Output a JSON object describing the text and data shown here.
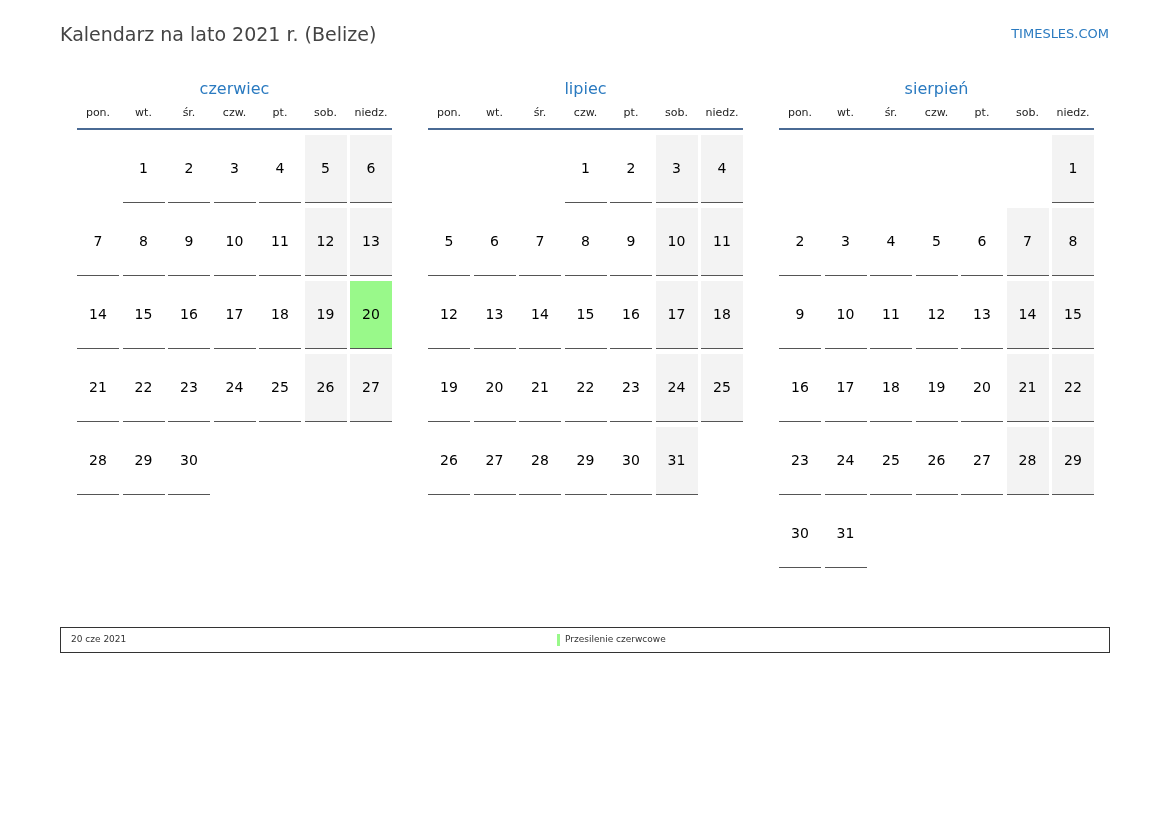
{
  "title": "Kalendarz na lato 2021 r. (Belize)",
  "site": "TIMESLES.COM",
  "months": [
    {
      "name": "czerwiec",
      "weekdays": [
        "pon.",
        "wt.",
        "śr.",
        "czw.",
        "pt.",
        "sob.",
        "niedz."
      ],
      "weeks": [
        {
          "kind": "first",
          "days": [
            {
              "d": "1",
              "kind": "weekday"
            },
            {
              "d": "2",
              "kind": "weekday"
            },
            {
              "d": "3",
              "kind": "weekday"
            },
            {
              "d": "4",
              "kind": "weekday"
            },
            {
              "d": "5",
              "kind": "weekend"
            },
            {
              "d": "6",
              "kind": "weekend"
            }
          ]
        },
        {
          "kind": "middle",
          "days": [
            {
              "d": "7",
              "kind": "weekday"
            },
            {
              "d": "8",
              "kind": "weekday"
            },
            {
              "d": "9",
              "kind": "weekday"
            },
            {
              "d": "10",
              "kind": "weekday"
            },
            {
              "d": "11",
              "kind": "weekday"
            },
            {
              "d": "12",
              "kind": "weekend"
            },
            {
              "d": "13",
              "kind": "weekend"
            }
          ]
        },
        {
          "kind": "middle",
          "days": [
            {
              "d": "14",
              "kind": "weekday"
            },
            {
              "d": "15",
              "kind": "weekday"
            },
            {
              "d": "16",
              "kind": "weekday"
            },
            {
              "d": "17",
              "kind": "weekday"
            },
            {
              "d": "18",
              "kind": "weekday"
            },
            {
              "d": "19",
              "kind": "weekend"
            },
            {
              "d": "20",
              "kind": "holiday",
              "color": "#99f98a"
            }
          ]
        },
        {
          "kind": "middle",
          "days": [
            {
              "d": "21",
              "kind": "weekday"
            },
            {
              "d": "22",
              "kind": "weekday"
            },
            {
              "d": "23",
              "kind": "weekday"
            },
            {
              "d": "24",
              "kind": "weekday"
            },
            {
              "d": "25",
              "kind": "weekday"
            },
            {
              "d": "26",
              "kind": "weekend"
            },
            {
              "d": "27",
              "kind": "weekend"
            }
          ]
        },
        {
          "kind": "last",
          "days": [
            {
              "d": "28",
              "kind": "weekday"
            },
            {
              "d": "29",
              "kind": "weekday"
            },
            {
              "d": "30",
              "kind": "weekday"
            }
          ]
        }
      ]
    },
    {
      "name": "lipiec",
      "weekdays": [
        "pon.",
        "wt.",
        "śr.",
        "czw.",
        "pt.",
        "sob.",
        "niedz."
      ],
      "weeks": [
        {
          "kind": "first",
          "days": [
            {
              "d": "1",
              "kind": "weekday"
            },
            {
              "d": "2",
              "kind": "weekday"
            },
            {
              "d": "3",
              "kind": "weekend"
            },
            {
              "d": "4",
              "kind": "weekend"
            }
          ]
        },
        {
          "kind": "middle",
          "days": [
            {
              "d": "5",
              "kind": "weekday"
            },
            {
              "d": "6",
              "kind": "weekday"
            },
            {
              "d": "7",
              "kind": "weekday"
            },
            {
              "d": "8",
              "kind": "weekday"
            },
            {
              "d": "9",
              "kind": "weekday"
            },
            {
              "d": "10",
              "kind": "weekend"
            },
            {
              "d": "11",
              "kind": "weekend"
            }
          ]
        },
        {
          "kind": "middle",
          "days": [
            {
              "d": "12",
              "kind": "weekday"
            },
            {
              "d": "13",
              "kind": "weekday"
            },
            {
              "d": "14",
              "kind": "weekday"
            },
            {
              "d": "15",
              "kind": "weekday"
            },
            {
              "d": "16",
              "kind": "weekday"
            },
            {
              "d": "17",
              "kind": "weekend"
            },
            {
              "d": "18",
              "kind": "weekend"
            }
          ]
        },
        {
          "kind": "middle",
          "days": [
            {
              "d": "19",
              "kind": "weekday"
            },
            {
              "d": "20",
              "kind": "weekday"
            },
            {
              "d": "21",
              "kind": "weekday"
            },
            {
              "d": "22",
              "kind": "weekday"
            },
            {
              "d": "23",
              "kind": "weekday"
            },
            {
              "d": "24",
              "kind": "weekend"
            },
            {
              "d": "25",
              "kind": "weekend"
            }
          ]
        },
        {
          "kind": "last",
          "days": [
            {
              "d": "26",
              "kind": "weekday"
            },
            {
              "d": "27",
              "kind": "weekday"
            },
            {
              "d": "28",
              "kind": "weekday"
            },
            {
              "d": "29",
              "kind": "weekday"
            },
            {
              "d": "30",
              "kind": "weekday"
            },
            {
              "d": "31",
              "kind": "weekend"
            }
          ]
        }
      ]
    },
    {
      "name": "sierpień",
      "weekdays": [
        "pon.",
        "wt.",
        "śr.",
        "czw.",
        "pt.",
        "sob.",
        "niedz."
      ],
      "weeks": [
        {
          "kind": "first",
          "days": [
            {
              "d": "1",
              "kind": "weekend"
            }
          ]
        },
        {
          "kind": "middle",
          "days": [
            {
              "d": "2",
              "kind": "weekday"
            },
            {
              "d": "3",
              "kind": "weekday"
            },
            {
              "d": "4",
              "kind": "weekday"
            },
            {
              "d": "5",
              "kind": "weekday"
            },
            {
              "d": "6",
              "kind": "weekday"
            },
            {
              "d": "7",
              "kind": "weekend"
            },
            {
              "d": "8",
              "kind": "weekend"
            }
          ]
        },
        {
          "kind": "middle",
          "days": [
            {
              "d": "9",
              "kind": "weekday"
            },
            {
              "d": "10",
              "kind": "weekday"
            },
            {
              "d": "11",
              "kind": "weekday"
            },
            {
              "d": "12",
              "kind": "weekday"
            },
            {
              "d": "13",
              "kind": "weekday"
            },
            {
              "d": "14",
              "kind": "weekend"
            },
            {
              "d": "15",
              "kind": "weekend"
            }
          ]
        },
        {
          "kind": "middle",
          "days": [
            {
              "d": "16",
              "kind": "weekday"
            },
            {
              "d": "17",
              "kind": "weekday"
            },
            {
              "d": "18",
              "kind": "weekday"
            },
            {
              "d": "19",
              "kind": "weekday"
            },
            {
              "d": "20",
              "kind": "weekday"
            },
            {
              "d": "21",
              "kind": "weekend"
            },
            {
              "d": "22",
              "kind": "weekend"
            }
          ]
        },
        {
          "kind": "middle",
          "days": [
            {
              "d": "23",
              "kind": "weekday"
            },
            {
              "d": "24",
              "kind": "weekday"
            },
            {
              "d": "25",
              "kind": "weekday"
            },
            {
              "d": "26",
              "kind": "weekday"
            },
            {
              "d": "27",
              "kind": "weekday"
            },
            {
              "d": "28",
              "kind": "weekend"
            },
            {
              "d": "29",
              "kind": "weekend"
            }
          ]
        },
        {
          "kind": "last",
          "days": [
            {
              "d": "30",
              "kind": "weekday"
            },
            {
              "d": "31",
              "kind": "weekday"
            }
          ]
        }
      ]
    }
  ],
  "legend": [
    {
      "date": "20 cze 2021",
      "name": "Przesilenie czerwcowe",
      "color": "#99f98a"
    }
  ]
}
